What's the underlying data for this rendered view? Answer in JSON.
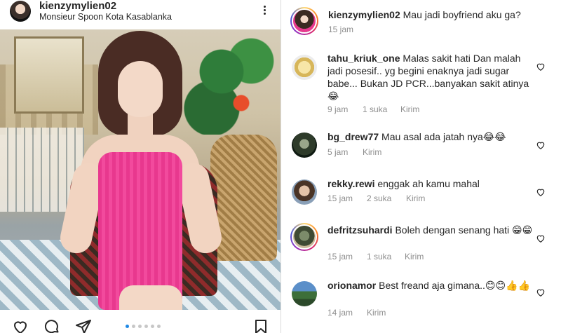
{
  "post": {
    "username": "kienzymylien02",
    "location": "Monsieur Spoon Kota Kasablanka",
    "carousel": {
      "count": 6,
      "active_index": 0
    }
  },
  "caption": {
    "username": "kienzymylien02",
    "text": "Mau jadi boyfriend aku ga?",
    "time": "15 jam"
  },
  "comments": [
    {
      "username": "tahu_kriuk_one",
      "text": "Malas sakit hati Dan malah jadi posesif.. yg begini enaknya jadi sugar babe... Bukan JD PCR...banyakan sakit atinya😂",
      "time": "9 jam",
      "likes": "1 suka",
      "reply": "Kirim"
    },
    {
      "username": "bg_drew77",
      "text": "Mau asal ada jatah nya😂😂",
      "time": "5 jam",
      "likes": "",
      "reply": "Kirim"
    },
    {
      "username": "rekky.rewi",
      "text": "enggak ah kamu mahal",
      "time": "15 jam",
      "likes": "2 suka",
      "reply": "Kirim"
    },
    {
      "username": "defritzsuhardi",
      "text": "Boleh dengan senang hati 😁😁",
      "time": "15 jam",
      "likes": "1 suka",
      "reply": "Kirim"
    },
    {
      "username": "orionamor",
      "text": "Best freand aja gimana..😊😊👍👍",
      "time": "14 jam",
      "likes": "",
      "reply": "Kirim"
    }
  ],
  "icons": {
    "more": "more-vertical-icon",
    "like": "heart-outline-icon",
    "comment": "comment-bubble-icon",
    "share": "paper-plane-icon",
    "save": "bookmark-icon",
    "comment_like": "small-heart-icon"
  },
  "colors": {
    "text": "#262626",
    "secondary": "#8e8e8e",
    "divider": "#dbdbdb",
    "carousel_active": "#1e88e5"
  }
}
